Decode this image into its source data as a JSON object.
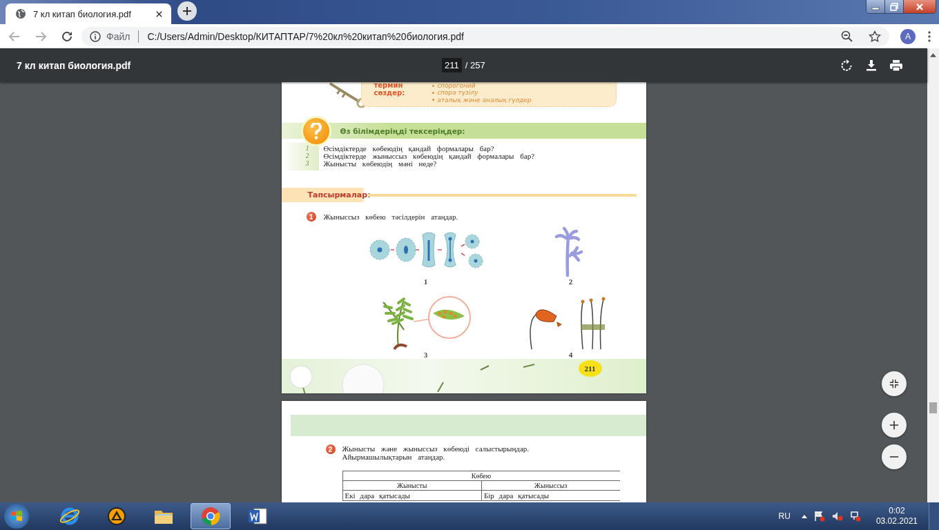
{
  "browser": {
    "tab": {
      "title": "7 кл китап биология.pdf",
      "selected": true
    },
    "address_bar": {
      "scheme": "Файл",
      "url": "C:/Users/Admin/Desktop/КИТАПТАР/7%20кл%20китап%20биология.pdf"
    },
    "profile_initial": "A"
  },
  "pdf_toolbar": {
    "title": "7 кл китап биология.pdf",
    "page": "211",
    "page_total": "/ 257"
  },
  "page_211": {
    "terms": {
      "heading": [
        "термин",
        "сөздер:"
      ],
      "items": [
        "спорогоний",
        "спора түзілу",
        "аталық және аналық гүлдер"
      ]
    },
    "check_section": {
      "title": "Өз білімдеріңді тексеріңдер:",
      "questions": [
        {
          "number": "1",
          "text": "Өсімдіктерде көбеюдің қандай формалары бар?"
        },
        {
          "number": "2",
          "text": "Өсімдіктерде жыныссыз көбеюдің қандай формалары бар?"
        },
        {
          "number": "3",
          "text": "Жынысты көбеюдің мәні неде?"
        }
      ]
    },
    "tasks_title": "Тапсырмалар:",
    "task": {
      "number": "1",
      "text": "Жыныссыз көбею тәсілдерін атаңдар."
    },
    "figures": [
      {
        "label": "1"
      },
      {
        "label": "2"
      },
      {
        "label": "3"
      },
      {
        "label": "4"
      }
    ],
    "page_number": "211"
  },
  "page_212": {
    "task": {
      "number": "2",
      "lines": [
        "Жынысты және жыныссыз көбеюді салыстырыңдар.",
        "Айырмашылықтарын атаңдар."
      ]
    },
    "table": {
      "caption": "Көбею",
      "columns": [
        "Жынысты",
        "Жыныссыз"
      ],
      "rows": [
        [
          "Екі дара қатысады",
          "Бір дара қатысады"
        ]
      ]
    }
  },
  "taskbar": {
    "apps": [
      {
        "selected": false
      },
      {
        "selected": false
      },
      {
        "selected": false
      },
      {
        "selected": true
      },
      {
        "selected": false
      }
    ],
    "language": "RU",
    "time": "0:02",
    "date": "03.02.2021"
  }
}
